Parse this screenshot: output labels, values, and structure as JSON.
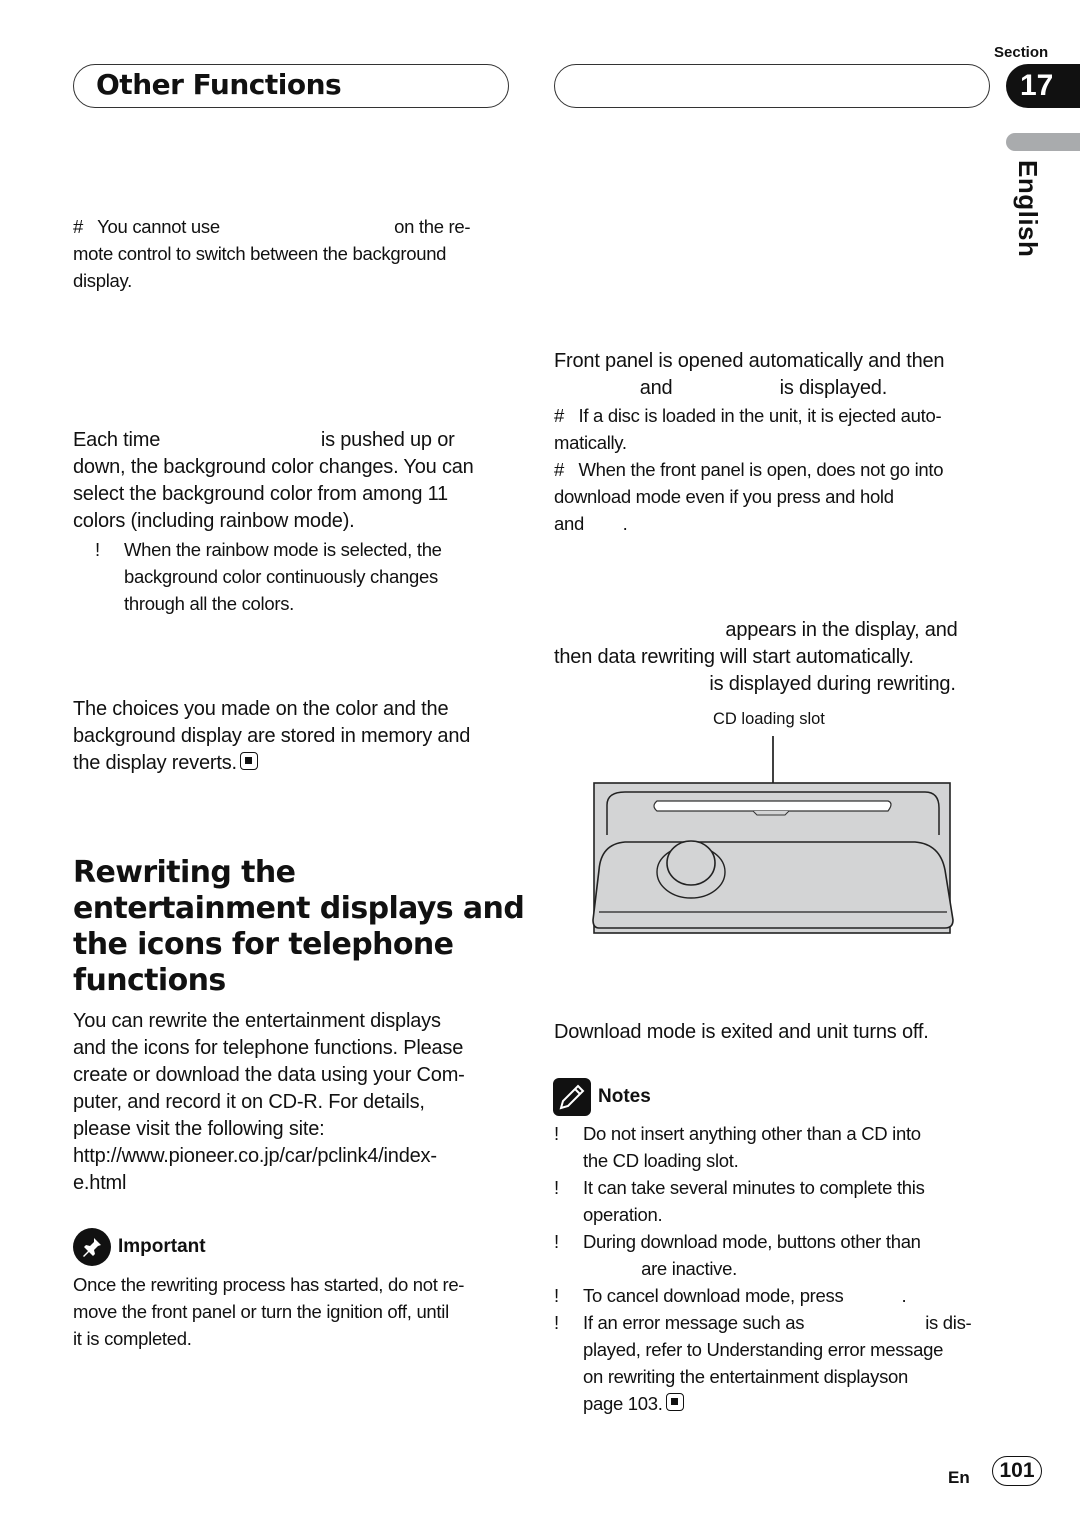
{
  "header": {
    "chapter_title": "Other Functions",
    "section_label": "Section",
    "section_number": "17",
    "language_tab": "English"
  },
  "left": {
    "note_remote": "#   You cannot use                                    on the re-\nmote control to switch between the background\ndisplay.",
    "color_para": "Each time                              is pushed up or\ndown, the background color changes. You can\nselect the background color from among 11\ncolors (including rainbow mode).",
    "rainbow_bullet_mark": "!",
    "rainbow_bullet": "When the rainbow mode is selected, the\nbackground color continuously changes\nthrough all the colors.",
    "memory_para": "The choices you made on the color and the\nbackground display are stored in memory and\nthe display reverts.",
    "heading": "Rewriting the\nentertainment displays and\nthe icons for telephone\nfunctions",
    "intro_para": "You can rewrite the entertainment displays\nand the icons for telephone functions. Please\ncreate or download the data using your Com-\nputer, and record it on CD-R. For details,\nplease visit the following site:\nhttp://www.pioneer.co.jp/car/pclink4/index-\ne.html",
    "important_title": "Important",
    "important_text": "Once the rewriting process has started, do not re-\nmove the front panel or turn the ignition off, until\nit is completed."
  },
  "right": {
    "panel_para": "Front panel is opened automatically and then\n                and                    is displayed.",
    "note_eject": "#   If a disc is loaded in the unit, it is ejected auto-\nmatically.",
    "note_open": "#   When the front panel is open, does not go into\ndownload mode even if you press and hold\nand        .",
    "appears_para": "                                appears in the display, and\nthen data rewriting will start automatically.\n                             is displayed during rewriting.",
    "diagram_callout": "CD loading slot",
    "exit_para": "Download mode is exited and unit turns off.",
    "notes_title": "Notes",
    "notes": [
      {
        "mark": "!",
        "text": "Do not insert anything other than a CD into\nthe CD loading slot."
      },
      {
        "mark": "!",
        "text": "It can take several minutes to complete this\noperation."
      },
      {
        "mark": "!",
        "text": "During download mode, buttons other than\n            are inactive."
      },
      {
        "mark": "!",
        "text": "To cancel download mode, press            ."
      },
      {
        "mark": "!",
        "text": "If an error message such as                         is dis-\nplayed, refer to Understanding error message\non rewriting the entertainment displayson\npage 103."
      }
    ]
  },
  "footer": {
    "lang": "En",
    "page": "101"
  },
  "icons": {
    "important": "pushpin-icon",
    "notes": "pencil-icon",
    "end_mark": "stop-square-icon"
  },
  "colors": {
    "text": "#111111",
    "section_tab": "#111111",
    "language_tab_bar": "#a9abad",
    "diagram_fill": "#d3d4d5"
  }
}
